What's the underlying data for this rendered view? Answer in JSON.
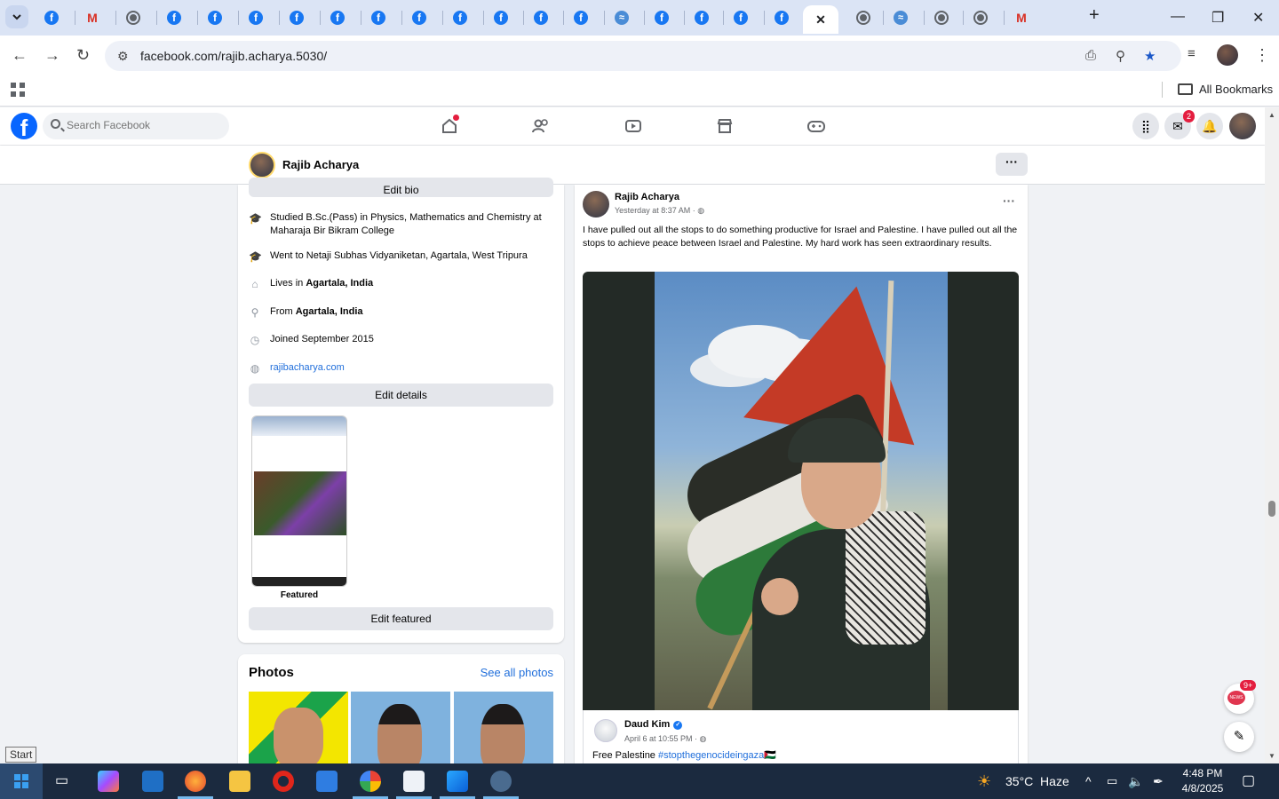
{
  "browser": {
    "url": "facebook.com/rajib.acharya.5030/",
    "bookmarks_label": "All Bookmarks",
    "tabs": [
      {
        "icon": "facebook-icon"
      },
      {
        "icon": "gmail-icon"
      },
      {
        "icon": "globe-icon"
      },
      {
        "icon": "facebook-icon"
      },
      {
        "icon": "facebook-icon"
      },
      {
        "icon": "facebook-icon"
      },
      {
        "icon": "facebook-icon"
      },
      {
        "icon": "facebook-icon"
      },
      {
        "icon": "facebook-icon"
      },
      {
        "icon": "facebook-icon"
      },
      {
        "icon": "facebook-icon"
      },
      {
        "icon": "facebook-icon"
      },
      {
        "icon": "facebook-icon"
      },
      {
        "icon": "facebook-icon"
      },
      {
        "icon": "website-icon"
      },
      {
        "icon": "facebook-icon"
      },
      {
        "icon": "facebook-icon"
      },
      {
        "icon": "facebook-icon"
      },
      {
        "icon": "facebook-icon"
      },
      {
        "icon": "close-icon",
        "active": true
      },
      {
        "icon": "globe-icon"
      },
      {
        "icon": "website-icon"
      },
      {
        "icon": "globe-icon"
      },
      {
        "icon": "globe-icon"
      },
      {
        "icon": "gmail-icon"
      }
    ]
  },
  "facebook": {
    "search_placeholder": "Search Facebook",
    "messenger_badge": "2",
    "profile_name": "Rajib Acharya",
    "more_label": "···"
  },
  "intro": {
    "edit_bio": "Edit bio",
    "rows": [
      {
        "icon": "graduation-cap-icon",
        "text": "Studied B.Sc.(Pass) in Physics, Mathematics and Chemistry at Maharaja Bir Bikram College"
      },
      {
        "icon": "graduation-cap-icon",
        "text": "Went to Netaji Subhas Vidyaniketan, Agartala, West Tripura"
      },
      {
        "icon": "home-icon",
        "prefix": "Lives in ",
        "bold": "Agartala, India"
      },
      {
        "icon": "location-pin-icon",
        "prefix": "From ",
        "bold": "Agartala, India"
      },
      {
        "icon": "clock-icon",
        "text": "Joined September 2015"
      },
      {
        "icon": "globe-icon",
        "link": "rajibacharya.com"
      }
    ],
    "edit_details": "Edit details",
    "featured_label": "Featured",
    "edit_featured": "Edit featured"
  },
  "photos": {
    "title": "Photos",
    "see_all": "See all photos"
  },
  "post": {
    "author": "Rajib Acharya",
    "time": "Yesterday at 8:37 AM · ",
    "text": "I have pulled out all the stops to do something productive for Israel and Palestine. I have pulled out all the stops to achieve peace between Israel and Palestine. My hard work has seen extraordinary results.",
    "shared": {
      "author": "Daud Kim",
      "time": "April 6 at 10:55 PM · ",
      "text": "Free Palestine ",
      "hashtag": "#stopthegenocideingaza",
      "flag": "🇵🇸"
    }
  },
  "floating": {
    "news_badge": "9+",
    "news_label": "NEWS"
  },
  "tooltip": {
    "start": "Start"
  },
  "taskbar": {
    "weather": "35°C  Haze",
    "time": "4:48 PM",
    "date": "4/8/2025"
  },
  "colors": {
    "facebook_blue": "#0866ff",
    "link_blue": "#216fdb",
    "badge_red": "#e41e3f",
    "taskbar": "#1b2a3f"
  }
}
